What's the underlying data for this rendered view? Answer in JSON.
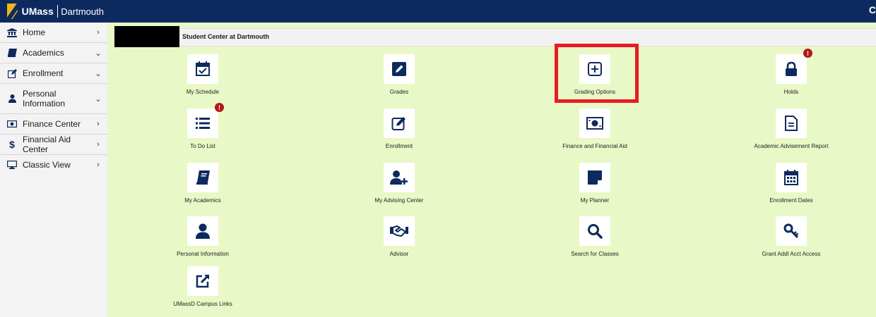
{
  "header": {
    "brand_main": "UMass",
    "brand_sub": "Dartmouth",
    "right_glyph": "C"
  },
  "sidebar": {
    "items": [
      {
        "label": "Home",
        "icon": "home-icon",
        "chevron": "›"
      },
      {
        "label": "Academics",
        "icon": "book-icon",
        "chevron": "⌄"
      },
      {
        "label": "Enrollment",
        "icon": "edit-icon",
        "chevron": "⌄"
      },
      {
        "label": "Personal Information",
        "icon": "user-icon",
        "chevron": "⌄"
      },
      {
        "label": "Finance Center",
        "icon": "money-icon",
        "chevron": "›"
      },
      {
        "label": "Financial Aid Center",
        "icon": "dollar-icon",
        "chevron": "›"
      },
      {
        "label": "Classic View",
        "icon": "monitor-icon",
        "chevron": "›"
      }
    ]
  },
  "main": {
    "title": "Student Center at Dartmouth",
    "tiles": [
      {
        "label": "My Schedule",
        "icon": "calendar-check-icon"
      },
      {
        "label": "Grades",
        "icon": "pencil-icon"
      },
      {
        "label": "Grading Options",
        "icon": "plus-square-icon"
      },
      {
        "label": "Holds",
        "icon": "lock-icon",
        "badge": "!"
      },
      {
        "label": "To Do List",
        "icon": "list-icon",
        "badge": "!"
      },
      {
        "label": "Enrollment",
        "icon": "edit-icon"
      },
      {
        "label": "Finance and Financial Aid",
        "icon": "money-icon"
      },
      {
        "label": "Academic Advisement Report",
        "icon": "document-icon"
      },
      {
        "label": "My Academics",
        "icon": "book-icon"
      },
      {
        "label": "My Advising Center",
        "icon": "user-plus-icon"
      },
      {
        "label": "My Planner",
        "icon": "note-icon"
      },
      {
        "label": "Enrollment Dates",
        "icon": "calendar-icon"
      },
      {
        "label": "Personal Information",
        "icon": "user-icon"
      },
      {
        "label": "Advisor",
        "icon": "handshake-icon"
      },
      {
        "label": "Search for Classes",
        "icon": "search-icon"
      },
      {
        "label": "Grant Addl Acct Access",
        "icon": "key-icon"
      },
      {
        "label": "UMassD Campus Links",
        "icon": "external-link-icon"
      }
    ]
  },
  "colors": {
    "header_bg": "#0d2a5e",
    "main_bg": "#e8f8c6",
    "icon": "#0d2a5e",
    "highlight": "#e81c25",
    "badge": "#b3181a"
  }
}
